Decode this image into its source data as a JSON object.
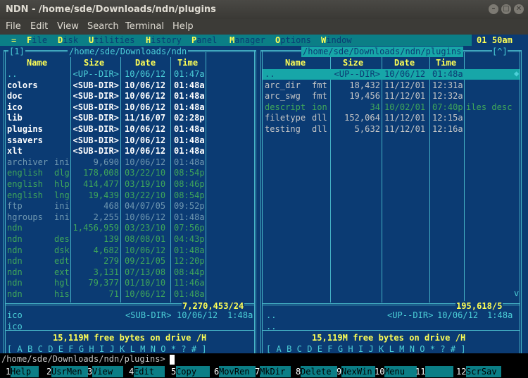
{
  "window": {
    "title": "NDN - /home/sde/Downloads/ndn/plugins"
  },
  "menubar": [
    "File",
    "Edit",
    "View",
    "Search",
    "Terminal",
    "Help"
  ],
  "app_menu": {
    "items": [
      {
        "hot": "F",
        "rest": "ile"
      },
      {
        "hot": "D",
        "rest": "isk"
      },
      {
        "hot": "U",
        "rest": "tilities"
      },
      {
        "hot": "H",
        "rest": "istory"
      },
      {
        "hot": "P",
        "rest": "anel"
      },
      {
        "hot": "M",
        "rest": "anager"
      },
      {
        "hot": "O",
        "rest": "ptions"
      },
      {
        "hot": "W",
        "rest": "indow"
      }
    ],
    "clock": "01 50am"
  },
  "left_panel": {
    "number": "[1]",
    "path": "/home/sde/Downloads/ndn",
    "columns": {
      "name": "Name",
      "size": "Size",
      "date": "Date",
      "time": "Time"
    },
    "rows": [
      {
        "name": "..",
        "ext": "",
        "size": "<UP--DIR>",
        "date": "10/06/12",
        "time": "01:47a",
        "style": "cyan"
      },
      {
        "name": "colors",
        "ext": "",
        "size": "<SUB-DIR>",
        "date": "10/06/12",
        "time": "01:48a",
        "style": "white"
      },
      {
        "name": "doc",
        "ext": "",
        "size": "<SUB-DIR>",
        "date": "10/06/12",
        "time": "01:48a",
        "style": "white"
      },
      {
        "name": "ico",
        "ext": "",
        "size": "<SUB-DIR>",
        "date": "10/06/12",
        "time": "01:48a",
        "style": "white"
      },
      {
        "name": "lib",
        "ext": "",
        "size": "<SUB-DIR>",
        "date": "11/16/07",
        "time": "02:28p",
        "style": "white"
      },
      {
        "name": "plugins",
        "ext": "",
        "size": "<SUB-DIR>",
        "date": "10/06/12",
        "time": "01:48a",
        "style": "white"
      },
      {
        "name": "ssavers",
        "ext": "",
        "size": "<SUB-DIR>",
        "date": "10/06/12",
        "time": "01:48a",
        "style": "white"
      },
      {
        "name": "xlt",
        "ext": "",
        "size": "<SUB-DIR>",
        "date": "10/06/12",
        "time": "01:48a",
        "style": "white"
      },
      {
        "name": "archiver",
        "ext": "ini",
        "size": "9,690",
        "date": "10/06/12",
        "time": "01:48a",
        "style": "dim"
      },
      {
        "name": "english",
        "ext": "dlg",
        "size": "178,008",
        "date": "03/22/10",
        "time": "08:54p",
        "style": "green"
      },
      {
        "name": "english",
        "ext": "hlp",
        "size": "414,477",
        "date": "03/19/10",
        "time": "08:46p",
        "style": "green"
      },
      {
        "name": "english",
        "ext": "lng",
        "size": "19,439",
        "date": "03/22/10",
        "time": "08:54p",
        "style": "green"
      },
      {
        "name": "ftp",
        "ext": "ini",
        "size": "468",
        "date": "04/07/05",
        "time": "09:52p",
        "style": "dim"
      },
      {
        "name": "hgroups",
        "ext": "ini",
        "size": "2,255",
        "date": "10/06/12",
        "time": "01:48a",
        "style": "dim"
      },
      {
        "name": "ndn",
        "ext": "",
        "size": "1,456,959",
        "date": "03/23/10",
        "time": "07:56p",
        "style": "green"
      },
      {
        "name": "ndn",
        "ext": "des",
        "size": "139",
        "date": "08/08/01",
        "time": "04:43p",
        "style": "green"
      },
      {
        "name": "ndn",
        "ext": "dsk",
        "size": "4,682",
        "date": "10/06/12",
        "time": "01:48a",
        "style": "green"
      },
      {
        "name": "ndn",
        "ext": "edt",
        "size": "279",
        "date": "09/21/05",
        "time": "12:20p",
        "style": "green"
      },
      {
        "name": "ndn",
        "ext": "ext",
        "size": "3,131",
        "date": "07/13/08",
        "time": "08:44p",
        "style": "green"
      },
      {
        "name": "ndn",
        "ext": "hgl",
        "size": "79,377",
        "date": "01/10/10",
        "time": "11:46a",
        "style": "green"
      },
      {
        "name": "ndn",
        "ext": "his",
        "size": "71",
        "date": "10/06/12",
        "time": "01:48a",
        "style": "green"
      }
    ],
    "total": "7,270,453/24",
    "info1": {
      "name": "ico",
      "size": "<SUB-DIR>",
      "date": "10/06/12",
      "time": "1:48a"
    },
    "info2": "ico",
    "free": "15,119M free bytes on drive /H",
    "drives": "[ A B C D E F G H I J K L M N O * ? # ]"
  },
  "right_panel": {
    "path": "/home/sde/Downloads/ndn/plugins",
    "marker": "[^]",
    "columns": {
      "name": "Name",
      "size": "Size",
      "date": "Date",
      "time": "Time"
    },
    "rows": [
      {
        "name": "..",
        "ext": "",
        "size": "<UP--DIR>",
        "date": "10/06/12",
        "time": "01:48a",
        "style": "selected"
      },
      {
        "name": "arc_dir",
        "ext": "fmt",
        "size": "18,432",
        "date": "11/12/01",
        "time": "12:31a",
        "style": "norm"
      },
      {
        "name": "arc_swg",
        "ext": "fmt",
        "size": "19,456",
        "date": "11/12/01",
        "time": "12:32a",
        "style": "norm"
      },
      {
        "name": "descript",
        "ext": "ion",
        "size": "34",
        "date": "10/02/01",
        "time": "07:40p",
        "style": "green",
        "desc": "iles desc"
      },
      {
        "name": "filetype",
        "ext": "dll",
        "size": "152,064",
        "date": "11/12/01",
        "time": "12:15a",
        "style": "norm"
      },
      {
        "name": "testing",
        "ext": "dll",
        "size": "5,632",
        "date": "11/12/01",
        "time": "12:16a",
        "style": "norm"
      }
    ],
    "total": "195,618/5",
    "info1": {
      "name": "..",
      "size": "<UP--DIR>",
      "date": "10/06/12",
      "time": "1:48a"
    },
    "info2": "..",
    "free": "15,119M free bytes on drive /H",
    "drives": "[ A B C D E F G H I J K L M N O * ? # ]"
  },
  "command_line": "/home/sde/Downloads/ndn/plugins>",
  "fkeys": [
    {
      "num": "1",
      "label": "Help"
    },
    {
      "num": "2",
      "label": "UsrMen"
    },
    {
      "num": "3",
      "label": "View"
    },
    {
      "num": "4",
      "label": "Edit"
    },
    {
      "num": "5",
      "label": "Copy"
    },
    {
      "num": "6",
      "label": "MovRen"
    },
    {
      "num": "7",
      "label": "MkDir"
    },
    {
      "num": "8",
      "label": "Delete"
    },
    {
      "num": "9",
      "label": "NexWin"
    },
    {
      "num": "10",
      "label": "Menu"
    },
    {
      "num": "11",
      "label": ""
    },
    {
      "num": "12",
      "label": "ScrSav"
    }
  ]
}
